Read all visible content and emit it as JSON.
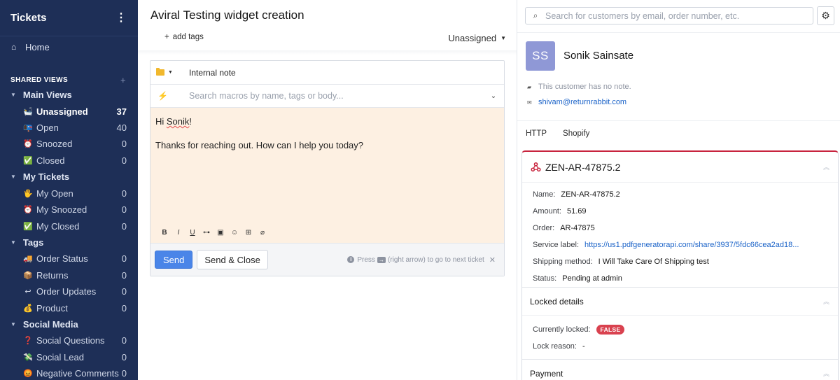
{
  "sidebar": {
    "title": "Tickets",
    "home": "Home",
    "shared_views": "SHARED VIEWS",
    "groups": [
      {
        "label": "Main Views",
        "items": [
          {
            "emoji": "🛀",
            "label": "Unassigned",
            "count": "37",
            "active": true
          },
          {
            "emoji": "📭",
            "label": "Open",
            "count": "40"
          },
          {
            "emoji": "⏰",
            "label": "Snoozed",
            "count": "0"
          },
          {
            "emoji": "✅",
            "label": "Closed",
            "count": "0"
          }
        ]
      },
      {
        "label": "My Tickets",
        "items": [
          {
            "emoji": "🖐",
            "label": "My Open",
            "count": "0"
          },
          {
            "emoji": "⏰",
            "label": "My Snoozed",
            "count": "0"
          },
          {
            "emoji": "✅",
            "label": "My Closed",
            "count": "0"
          }
        ]
      },
      {
        "label": "Tags",
        "items": [
          {
            "emoji": "🚚",
            "label": "Order Status",
            "count": "0"
          },
          {
            "emoji": "📦",
            "label": "Returns",
            "count": "0"
          },
          {
            "emoji": "↩",
            "label": "Order Updates",
            "count": "0"
          },
          {
            "emoji": "💰",
            "label": "Product",
            "count": "0"
          }
        ]
      },
      {
        "label": "Social Media",
        "items": [
          {
            "emoji": "❓",
            "label": "Social Questions",
            "count": "0"
          },
          {
            "emoji": "💸",
            "label": "Social Lead",
            "count": "0"
          },
          {
            "emoji": "😡",
            "label": "Negative Comments",
            "count": "0"
          }
        ]
      }
    ]
  },
  "ticket": {
    "title": "Aviral Testing widget creation",
    "add_tags": "add tags",
    "assignee": "Unassigned"
  },
  "composer": {
    "channel": "Internal note",
    "macro_placeholder": "Search macros by name, tags or body...",
    "greeting_prefix": "Hi ",
    "greeting_name": "Sonik",
    "greeting_suffix": "!",
    "body_line": "Thanks for reaching out. How can I help you today?",
    "send": "Send",
    "send_close": "Send & Close",
    "hint_press": "Press",
    "hint_key": "→",
    "hint_rest": "(right arrow) to go to next ticket"
  },
  "customer": {
    "search_placeholder": "Search for customers by email, order number, etc.",
    "initials": "SS",
    "name": "Sonik Sainsate",
    "note": "This customer has no note.",
    "email": "shivam@returnrabbit.com",
    "tabs": [
      "HTTP",
      "Shopify"
    ]
  },
  "widget": {
    "title": "ZEN-AR-47875.2",
    "accent": "#c8243e",
    "fields": [
      {
        "key": "Name:",
        "value": "ZEN-AR-47875.2"
      },
      {
        "key": "Amount:",
        "value": "51.69"
      },
      {
        "key": "Order:",
        "value": "AR-47875"
      },
      {
        "key": "Service label:",
        "value": "https://us1.pdfgeneratorapi.com/share/3937/5fdc66cea2ad18..."
      },
      {
        "key": "Shipping method:",
        "value": "I Will Take Care Of Shipping test"
      },
      {
        "key": "Status:",
        "value": "Pending at admin"
      }
    ],
    "locked_title": "Locked details",
    "locked_label": "Currently locked:",
    "locked_badge": "FALSE",
    "lock_reason_label": "Lock reason:",
    "lock_reason_value": "-",
    "payment_title": "Payment"
  }
}
